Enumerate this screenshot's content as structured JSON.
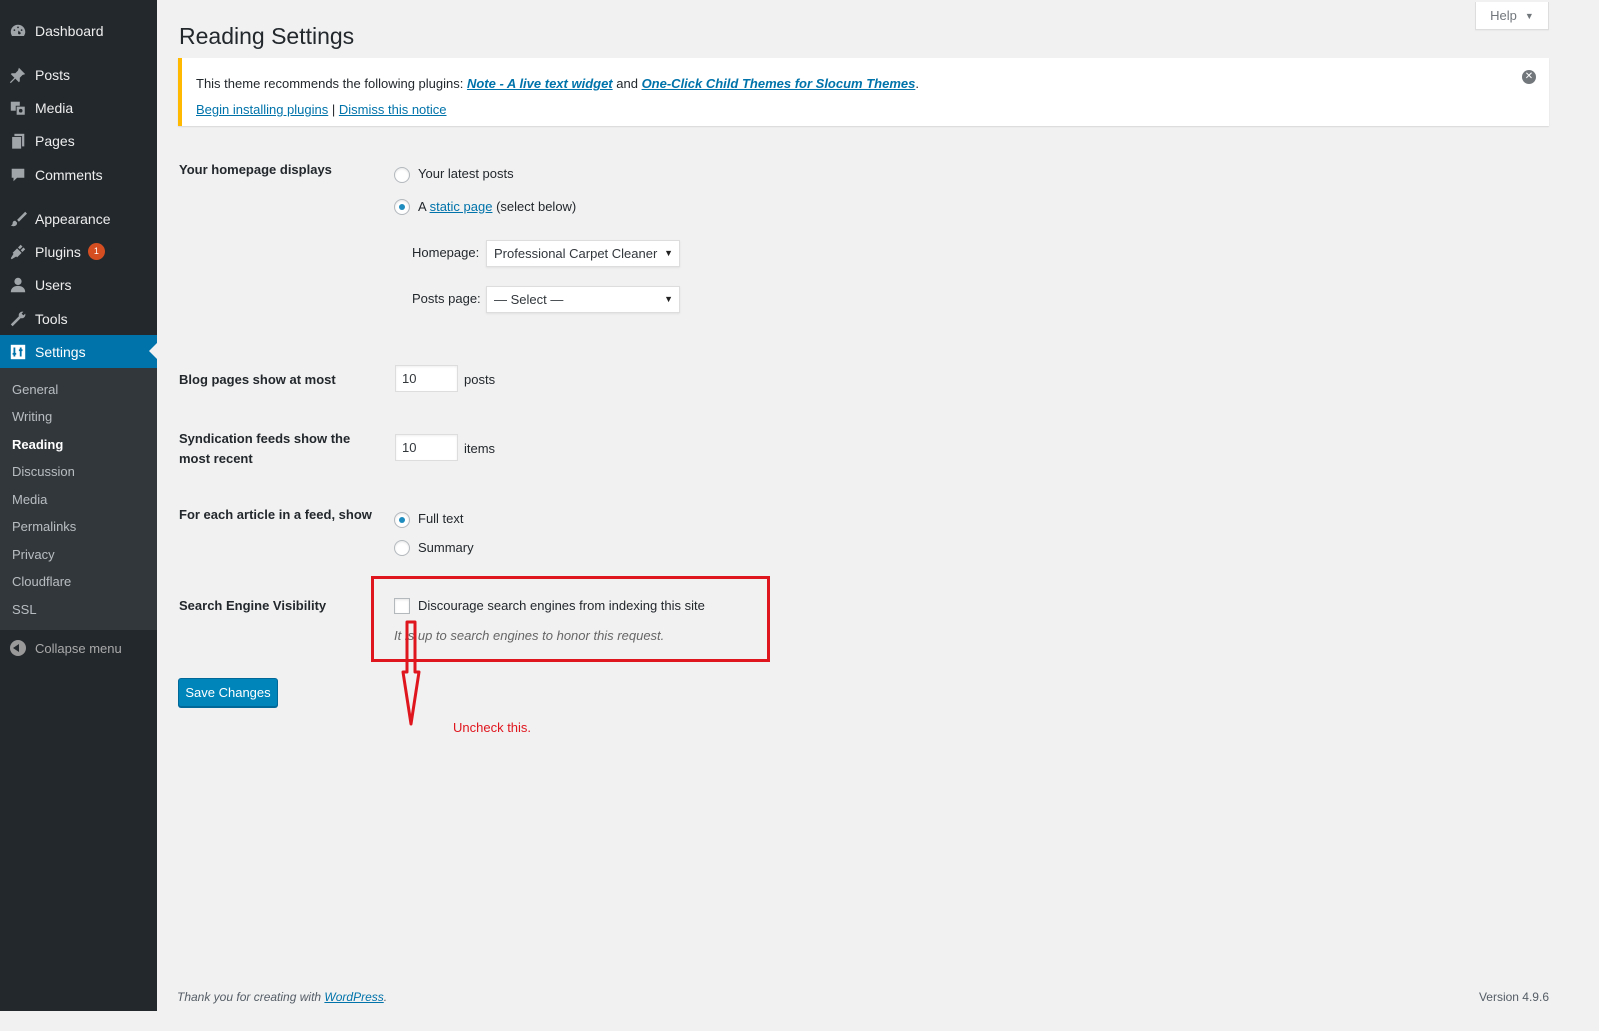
{
  "sidebar": {
    "items": [
      {
        "label": "Dashboard",
        "icon": "dashboard-icon"
      },
      {
        "label": "Posts",
        "icon": "pin-icon"
      },
      {
        "label": "Media",
        "icon": "media-icon"
      },
      {
        "label": "Pages",
        "icon": "pages-icon"
      },
      {
        "label": "Comments",
        "icon": "comment-icon"
      },
      {
        "label": "Appearance",
        "icon": "brush-icon"
      },
      {
        "label": "Plugins",
        "icon": "plugin-icon",
        "badge": "1"
      },
      {
        "label": "Users",
        "icon": "user-icon"
      },
      {
        "label": "Tools",
        "icon": "wrench-icon"
      },
      {
        "label": "Settings",
        "icon": "settings-icon"
      }
    ],
    "submenu": [
      "General",
      "Writing",
      "Reading",
      "Discussion",
      "Media",
      "Permalinks",
      "Privacy",
      "Cloudflare",
      "SSL"
    ],
    "collapse_label": "Collapse menu"
  },
  "header": {
    "help_label": "Help",
    "title": "Reading Settings"
  },
  "notice": {
    "text_before": "This theme recommends the following plugins: ",
    "plugin1": "Note - A live text widget",
    "and": " and ",
    "plugin2": "One-Click Child Themes for Slocum Themes",
    "period": ".",
    "begin_link": "Begin installing plugins",
    "separator": " | ",
    "dismiss_link": "Dismiss this notice"
  },
  "form": {
    "homepage_displays": {
      "label": "Your homepage displays",
      "option_latest": "Your latest posts",
      "option_static_prefix": "A ",
      "option_static_link": "static page",
      "option_static_suffix": " (select below)",
      "selected": "static",
      "homepage_label": "Homepage:",
      "homepage_value": "Professional Carpet Cleaner",
      "posts_page_label": "Posts page:",
      "posts_page_value": "— Select —"
    },
    "blog_pages": {
      "label": "Blog pages show at most",
      "value": "10",
      "unit": "posts"
    },
    "syndication": {
      "label_line1": "Syndication feeds show the",
      "label_line2": "most recent",
      "value": "10",
      "unit": "items"
    },
    "feed_article": {
      "label": "For each article in a feed, show",
      "option_full": "Full text",
      "option_summary": "Summary",
      "selected": "full"
    },
    "search_visibility": {
      "label": "Search Engine Visibility",
      "checkbox_label": "Discourage search engines from indexing this site",
      "checked": false,
      "description": "It is up to search engines to honor this request."
    },
    "save_label": "Save Changes"
  },
  "annotation": {
    "text": "Uncheck this.",
    "color": "#e0161e"
  },
  "footer": {
    "thanks_prefix": "Thank you for creating with ",
    "thanks_link": "WordPress",
    "thanks_suffix": ".",
    "version": "Version 4.9.6"
  },
  "colors": {
    "sidebar_bg": "#23282d",
    "accent": "#0073aa",
    "notice_warning": "#ffb900",
    "badge": "#d54e21"
  }
}
